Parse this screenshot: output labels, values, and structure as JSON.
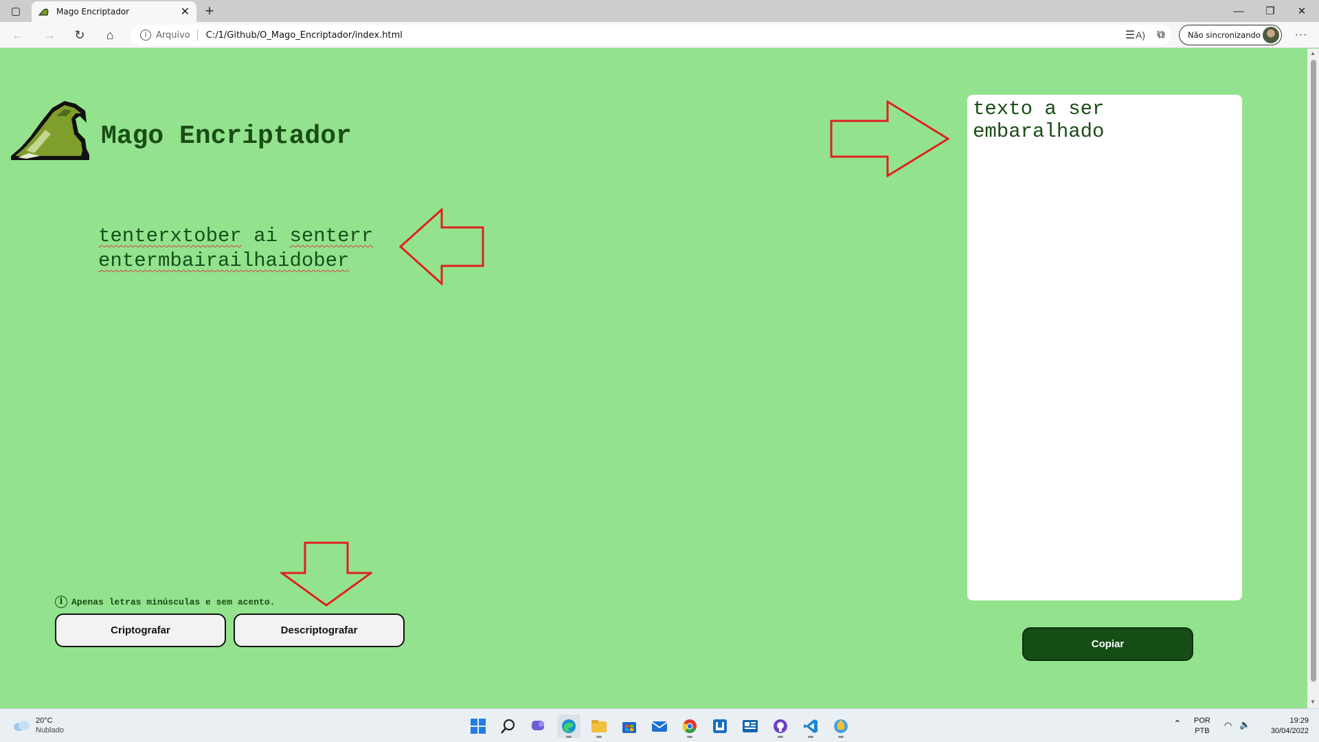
{
  "browser": {
    "tab_title": "Mago Encriptador",
    "address_protocol": "Arquivo",
    "address_url": "C:/1/Github/O_Mago_Encriptador/index.html",
    "profile_label": "Não sincronizando",
    "read_aloud_glyph": "A)"
  },
  "page": {
    "brand_title": "Mago Encriptador",
    "output_words": [
      "tenterxtober",
      "ai",
      "senterr",
      "entermbairailhaidober"
    ],
    "input_text": "texto a ser embaralhado",
    "hint_text": "Apenas letras minúsculas e sem acento.",
    "encrypt_label": "Criptografar",
    "decrypt_label": "Descriptografar",
    "copy_label": "Copiar",
    "colors": {
      "background": "#93e38e",
      "dark_green": "#154d15",
      "arrow_red": "#e02020"
    }
  },
  "taskbar": {
    "weather_temp": "20°C",
    "weather_desc": "Nublado",
    "lang_line1": "POR",
    "lang_line2": "PTB",
    "time": "19:29",
    "date": "30/04/2022",
    "apps": [
      "start-icon",
      "search-icon",
      "chat-icon",
      "edge-icon",
      "file-explorer-icon",
      "store-icon",
      "mail-icon",
      "chrome-icon",
      "app-icon",
      "news-icon",
      "github-desktop-icon",
      "vscode-icon",
      "puzzle-icon"
    ]
  }
}
